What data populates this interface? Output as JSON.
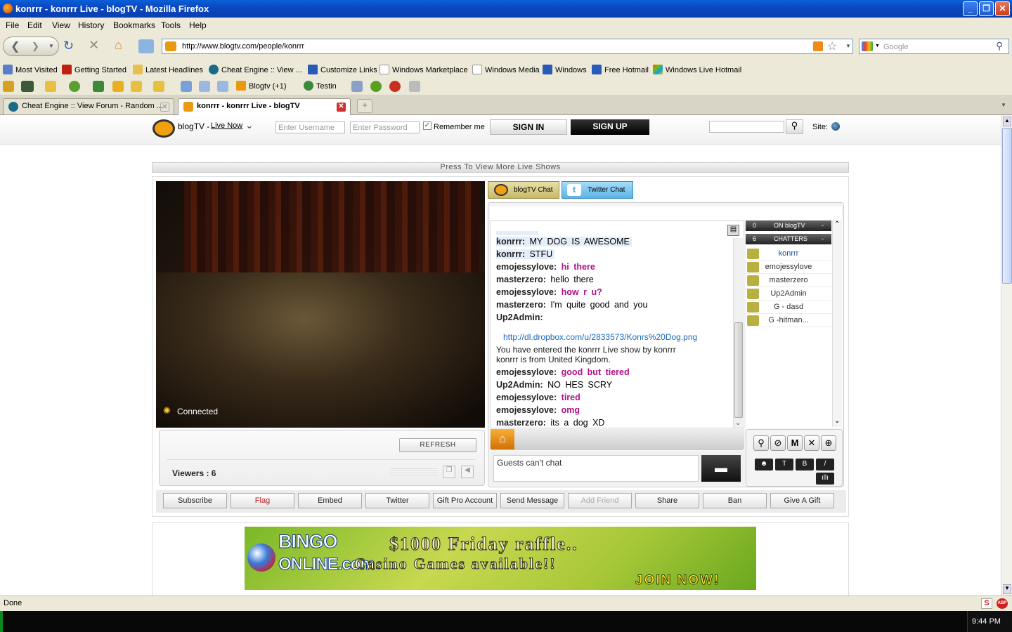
{
  "window": {
    "title": "konrrr - konrrr Live - blogTV - Mozilla Firefox"
  },
  "menubar": [
    "File",
    "Edit",
    "View",
    "History",
    "Bookmarks",
    "Tools",
    "Help"
  ],
  "nav": {
    "url": "http://www.blogtv.com/people/konrrr",
    "search_placeholder": "Google"
  },
  "bookmarks": [
    "Most Visited",
    "Getting Started",
    "Latest Headlines",
    "Cheat Engine :: View ...",
    "Customize Links",
    "Windows Marketplace",
    "Windows Media",
    "Windows",
    "Free Hotmail",
    "Windows Live Hotmail"
  ],
  "toolbar2": {
    "blogtv": "Blogtv (+1)",
    "testin": "Testin"
  },
  "tabs": [
    {
      "label": "Cheat Engine :: View Forum - Random ..."
    },
    {
      "label": "konrrr - konrrr Live - blogTV"
    }
  ],
  "site": {
    "logo_text": "blogTV -",
    "live_now": "Live Now",
    "username_placeholder": "Enter Username",
    "password_placeholder": "Enter Password",
    "remember_me": "Remember me",
    "sign_in": "SIGN IN",
    "sign_up": "SIGN UP",
    "site_label": "Site:",
    "more_shows": "Press To View More Live Shows",
    "connected": "Connected",
    "refresh": "REFRESH",
    "viewers": "Viewers : 6",
    "chat_tab": "blogTV Chat",
    "twitter_tab": "Twitter Chat",
    "chat_lines": [
      {
        "user": "konrrr:",
        "msg": "MY DOG IS AWESOME",
        "style": "hl"
      },
      {
        "user": "konrrr:",
        "msg": "STFU",
        "style": "hl"
      },
      {
        "user": "emojessylove:",
        "msg": "hi there",
        "style": "pink"
      },
      {
        "user": "masterzero:",
        "msg": "hello there",
        "style": "plain"
      },
      {
        "user": "emojessylove:",
        "msg": "how r u?",
        "style": "pink"
      },
      {
        "user": "masterzero:",
        "msg": "I'm quite good and you",
        "style": "plain"
      },
      {
        "user": "Up2Admin:",
        "msg": "",
        "style": "plain"
      }
    ],
    "chat_link": "http://dl.dropbox.com/u/2833573/Konrs%20Dog.png",
    "system_msg_1": "You have entered the konrrr Live show by konrrr",
    "system_msg_2": "konrrr is from United Kingdom.",
    "chat_lines2": [
      {
        "user": "emojessylove:",
        "msg": "good but tiered",
        "style": "pink"
      },
      {
        "user": "Up2Admin:",
        "msg": "NO HES SCRY",
        "style": "plain"
      },
      {
        "user": "emojessylove:",
        "msg": "tired",
        "style": "pink"
      },
      {
        "user": "emojessylove:",
        "msg": "omg",
        "style": "pink"
      },
      {
        "user": "masterzero:",
        "msg": "its a dog XD",
        "style": "plain"
      }
    ],
    "on_blogtv_count": "0",
    "on_blogtv_label": "ON blogTV",
    "chatters_count": "6",
    "chatters_label": "CHATTERS",
    "chatters": [
      "konrrr",
      "emojessylove",
      "masterzero",
      "Up2Admin",
      "G - dasd",
      "G -hitman..."
    ],
    "guest_msg": "Guests can't chat",
    "action_buttons": [
      "Subscribe",
      "Flag",
      "Embed",
      "Twitter",
      "Gift Pro Account",
      "Send Message",
      "Add Friend",
      "Share",
      "Ban",
      "Give A Gift"
    ],
    "ad": {
      "brand1": "BINGO",
      "brand2": "ONLINE.com",
      "line1": "$1000 Friday raffle..",
      "line2": "Casino Games available!!",
      "cta": "JOIN NOW!"
    }
  },
  "status": "Done",
  "clock": "9:44 PM"
}
